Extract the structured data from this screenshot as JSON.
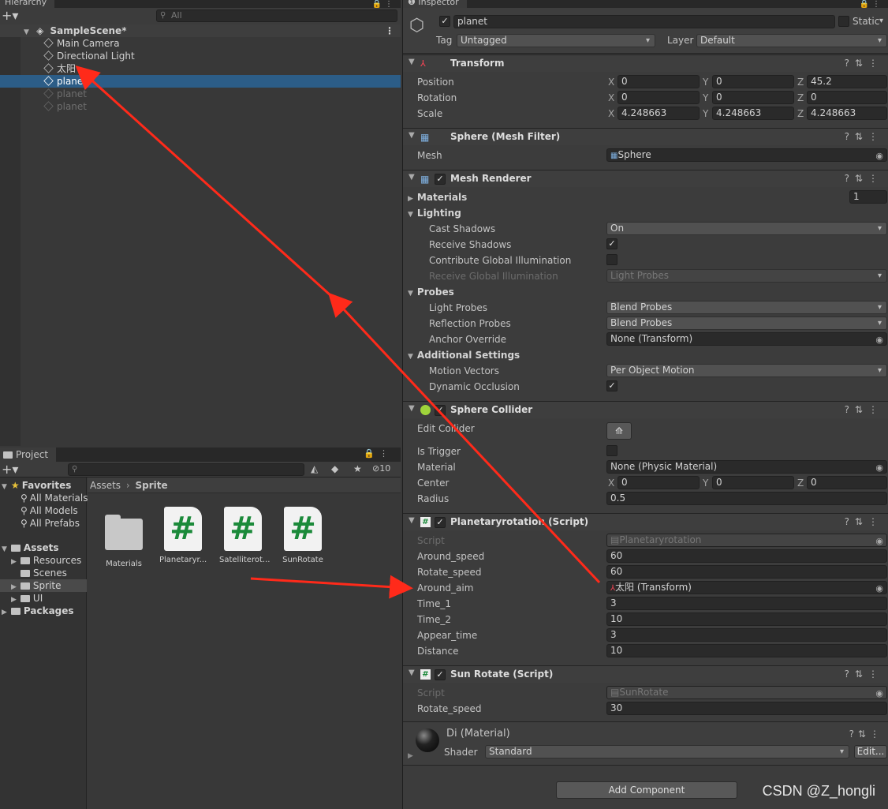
{
  "hierarchy": {
    "tab": "Hierarchy",
    "search_placeholder": "All",
    "scene": "SampleScene*",
    "items": [
      {
        "label": "Main Camera"
      },
      {
        "label": "Directional Light"
      },
      {
        "label": "太阳"
      },
      {
        "label": "planet"
      },
      {
        "label": "planet"
      },
      {
        "label": "planet"
      }
    ]
  },
  "project": {
    "tab": "Project",
    "hidden_count": "10",
    "favorites": {
      "label": "Favorites",
      "items": [
        "All Materials",
        "All Models",
        "All Prefabs"
      ]
    },
    "assets": {
      "label": "Assets",
      "items": [
        "Resources",
        "Scenes",
        "Sprite",
        "UI"
      ]
    },
    "packages": "Packages",
    "breadcrumb": {
      "root": "Assets",
      "current": "Sprite"
    },
    "files": [
      {
        "label": "Materials",
        "kind": "folder"
      },
      {
        "label": "Planetaryr...",
        "kind": "script"
      },
      {
        "label": "Satelliterot...",
        "kind": "script"
      },
      {
        "label": "SunRotate",
        "kind": "script"
      }
    ]
  },
  "inspector": {
    "tab": "Inspector",
    "name": "planet",
    "static_label": "Static",
    "tag_label": "Tag",
    "tag_value": "Untagged",
    "layer_label": "Layer",
    "layer_value": "Default",
    "transform": {
      "title": "Transform",
      "position": {
        "label": "Position",
        "x": "0",
        "y": "0",
        "z": "45.2"
      },
      "rotation": {
        "label": "Rotation",
        "x": "0",
        "y": "0",
        "z": "0"
      },
      "scale": {
        "label": "Scale",
        "x": "4.248663",
        "y": "4.248663",
        "z": "4.248663"
      }
    },
    "mesh_filter": {
      "title": "Sphere (Mesh Filter)",
      "mesh_label": "Mesh",
      "mesh_value": "Sphere"
    },
    "mesh_renderer": {
      "title": "Mesh Renderer",
      "materials_label": "Materials",
      "materials_count": "1",
      "lighting": "Lighting",
      "cast_shadows": {
        "label": "Cast Shadows",
        "value": "On"
      },
      "receive_shadows": "Receive Shadows",
      "contribute_gi": "Contribute Global Illumination",
      "receive_gi": {
        "label": "Receive Global Illumination",
        "value": "Light Probes"
      },
      "probes": "Probes",
      "light_probes": {
        "label": "Light Probes",
        "value": "Blend Probes"
      },
      "reflection_probes": {
        "label": "Reflection Probes",
        "value": "Blend Probes"
      },
      "anchor_override": {
        "label": "Anchor Override",
        "value": "None (Transform)"
      },
      "additional": "Additional Settings",
      "motion_vectors": {
        "label": "Motion Vectors",
        "value": "Per Object Motion"
      },
      "dynamic_occlusion": "Dynamic Occlusion"
    },
    "sphere_collider": {
      "title": "Sphere Collider",
      "edit_collider": "Edit Collider",
      "is_trigger": "Is Trigger",
      "material": {
        "label": "Material",
        "value": "None (Physic Material)"
      },
      "center": {
        "label": "Center",
        "x": "0",
        "y": "0",
        "z": "0"
      },
      "radius": {
        "label": "Radius",
        "value": "0.5"
      }
    },
    "planetary": {
      "title": "Planetaryrotation (Script)",
      "script": {
        "label": "Script",
        "value": "Planetaryrotation"
      },
      "fields": [
        {
          "label": "Around_speed",
          "value": "60"
        },
        {
          "label": "Rotate_speed",
          "value": "60"
        },
        {
          "label": "Around_aim",
          "value": "太阳 (Transform)"
        },
        {
          "label": "Time_1",
          "value": "3"
        },
        {
          "label": "Time_2",
          "value": "10"
        },
        {
          "label": "Appear_time",
          "value": "3"
        },
        {
          "label": "Distance",
          "value": "10"
        }
      ]
    },
    "sun_rotate": {
      "title": "Sun Rotate (Script)",
      "script": {
        "label": "Script",
        "value": "SunRotate"
      },
      "rotate_speed": {
        "label": "Rotate_speed",
        "value": "30"
      }
    },
    "material": {
      "title": "Di (Material)",
      "shader_label": "Shader",
      "shader_value": "Standard",
      "edit": "Edit..."
    },
    "add_component": "Add Component"
  },
  "watermark": "CSDN @Z_hongli",
  "annotation_color": "#ff2a1a"
}
